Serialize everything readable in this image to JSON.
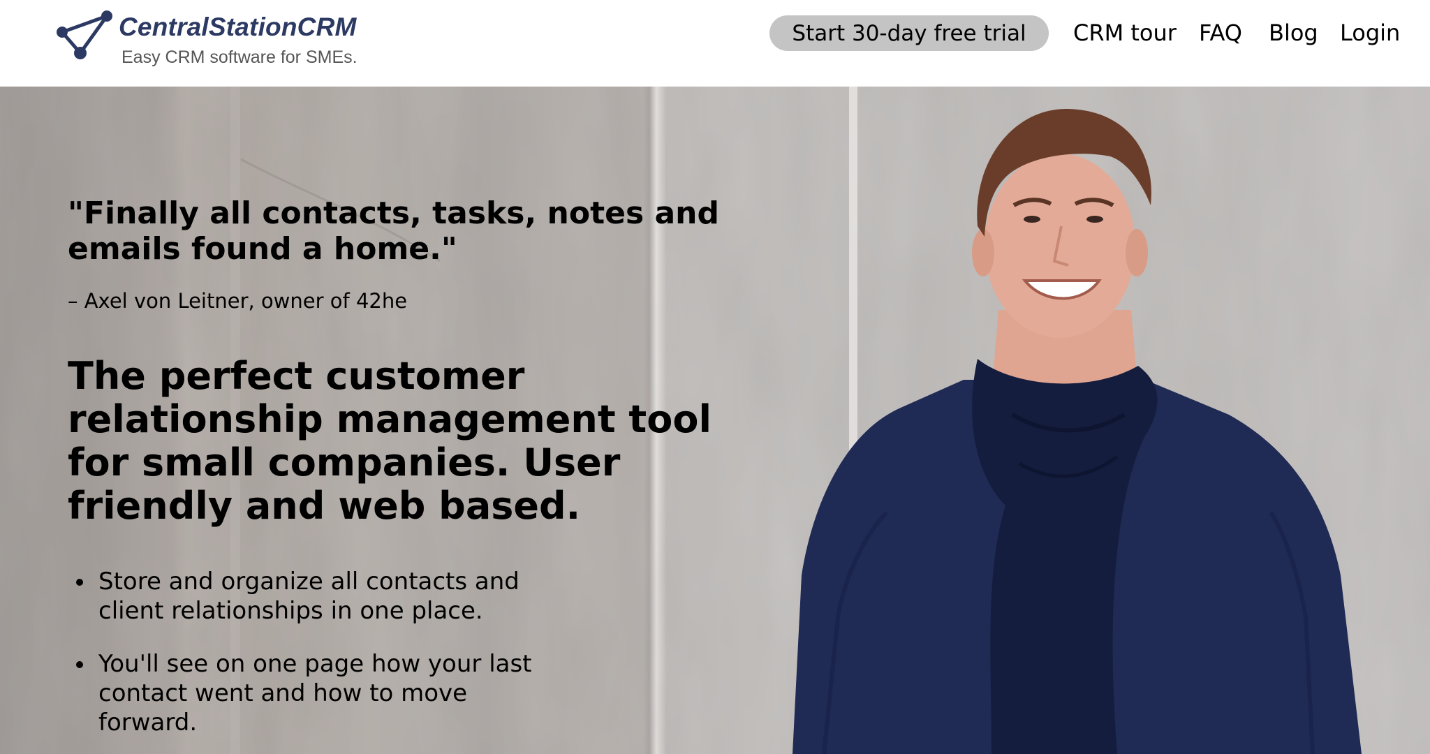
{
  "brand": {
    "name": "CentralStationCRM",
    "tagline": "Easy CRM software for SMEs.",
    "color": "#2c3a63"
  },
  "nav": {
    "trial_button": "Start 30-day free trial",
    "links": [
      "CRM tour",
      "FAQ",
      "Blog",
      "Login"
    ]
  },
  "hero": {
    "quote": "\"Finally all contacts, tasks, notes and emails found a home.\"",
    "quote_author": "– Axel von Leitner, owner of 42he",
    "headline": "The perfect customer relationship management tool for small companies. User friendly and web based.",
    "features": [
      "Store and organize all contacts and client relationships in one place.",
      "You'll see on one page how your last contact went and how to move forward."
    ]
  },
  "colors": {
    "trial_button_bg": "#c4c4c4",
    "text": "#000000"
  }
}
